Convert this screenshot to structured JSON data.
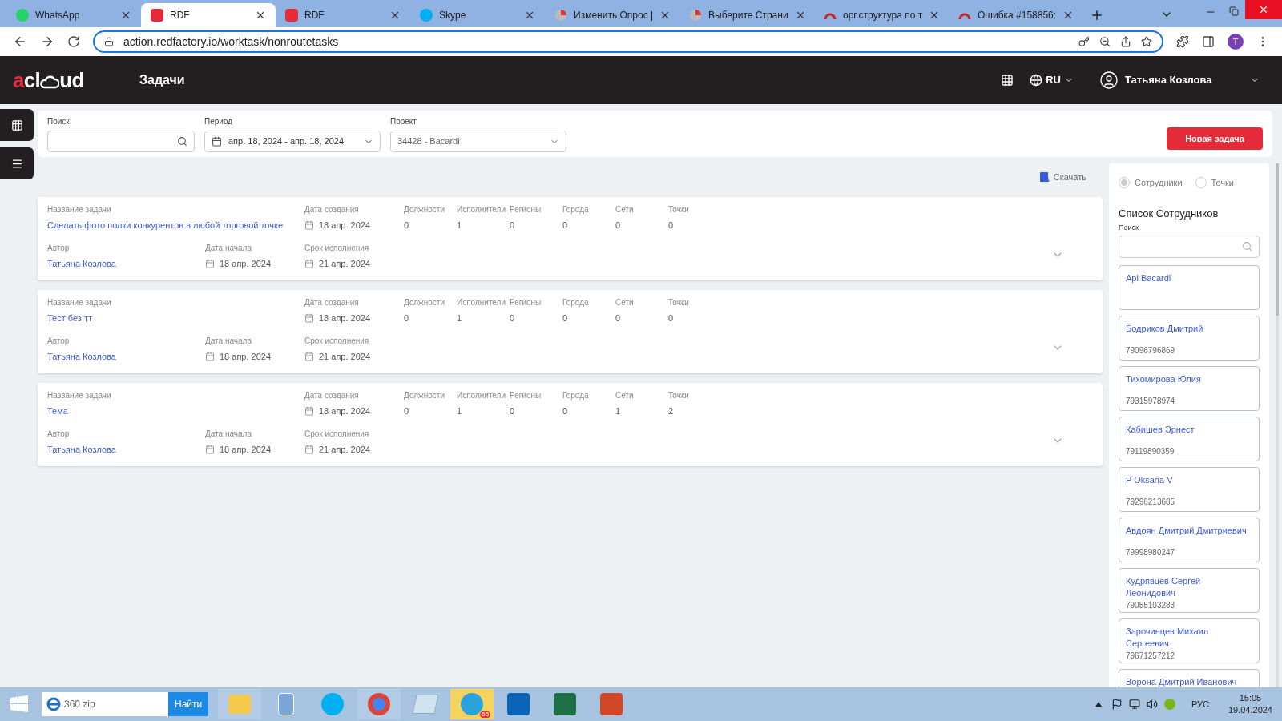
{
  "browser": {
    "tabs": [
      {
        "title": "WhatsApp",
        "kind": "whatsapp",
        "selected": false
      },
      {
        "title": "RDF",
        "kind": "rdf",
        "selected": true
      },
      {
        "title": "RDF",
        "kind": "rdf",
        "selected": false
      },
      {
        "title": "Skype",
        "kind": "skype",
        "selected": false
      },
      {
        "title": "Изменить Опрос |",
        "kind": "pie",
        "selected": false
      },
      {
        "title": "Выберите Страни",
        "kind": "pie",
        "selected": false
      },
      {
        "title": "орг.структура по т",
        "kind": "arc",
        "selected": false
      },
      {
        "title": "Ошибка #158856:",
        "kind": "arc",
        "selected": false
      }
    ],
    "url": "action.redfactory.io/worktask/nonroutetasks",
    "profile": "T"
  },
  "header": {
    "logo": {
      "mark": "a",
      "middle": "cl",
      "end": "ud"
    },
    "title": "Задачи",
    "language": "RU",
    "user": "Татьяна Козлова"
  },
  "filters": {
    "search": {
      "label": "Поиск"
    },
    "period": {
      "label": "Период",
      "value": "апр. 18, 2024 - апр. 18, 2024"
    },
    "project": {
      "label": "Проект",
      "value": "34428 - Bacardi"
    },
    "new_button": "Новая задача"
  },
  "download": "Скачать",
  "tasks": [
    {
      "name_label": "Название задачи",
      "name": "Сделать фото полки конкурентов в любой торговой точке",
      "created_label": "Дата создания",
      "created": "18 апр. 2024",
      "counts": [
        {
          "label": "Должности",
          "value": "0"
        },
        {
          "label": "Исполнители",
          "value": "1"
        },
        {
          "label": "Регионы",
          "value": "0"
        },
        {
          "label": "Города",
          "value": "0"
        },
        {
          "label": "Сети",
          "value": "0"
        },
        {
          "label": "Точки",
          "value": "0"
        }
      ],
      "author_label": "Автор",
      "author": "Татьяна Козлова",
      "start_label": "Дата начала",
      "start": "18 апр. 2024",
      "due_label": "Срок исполнения",
      "due": "21 апр. 2024"
    },
    {
      "name_label": "Название задачи",
      "name": "Тест без тт",
      "created_label": "Дата создания",
      "created": "18 апр. 2024",
      "counts": [
        {
          "label": "Должности",
          "value": "0"
        },
        {
          "label": "Исполнители",
          "value": "1"
        },
        {
          "label": "Регионы",
          "value": "0"
        },
        {
          "label": "Города",
          "value": "0"
        },
        {
          "label": "Сети",
          "value": "0"
        },
        {
          "label": "Точки",
          "value": "0"
        }
      ],
      "author_label": "Автор",
      "author": "Татьяна Козлова",
      "start_label": "Дата начала",
      "start": "18 апр. 2024",
      "due_label": "Срок исполнения",
      "due": "21 апр. 2024"
    },
    {
      "name_label": "Название задачи",
      "name": "Тема",
      "created_label": "Дата создания",
      "created": "18 апр. 2024",
      "counts": [
        {
          "label": "Должности",
          "value": "0"
        },
        {
          "label": "Исполнители",
          "value": "1"
        },
        {
          "label": "Регионы",
          "value": "0"
        },
        {
          "label": "Города",
          "value": "0"
        },
        {
          "label": "Сети",
          "value": "1"
        },
        {
          "label": "Точки",
          "value": "2"
        }
      ],
      "author_label": "Автор",
      "author": "Татьяна Козлова",
      "start_label": "Дата начала",
      "start": "18 апр. 2024",
      "due_label": "Срок исполнения",
      "due": "21 апр. 2024"
    }
  ],
  "side_panel": {
    "modes": [
      {
        "label": "Сотрудники",
        "selected": true
      },
      {
        "label": "Точки",
        "selected": false
      }
    ],
    "title": "Список Сотрудников",
    "search_label": "Поиск",
    "employees": [
      {
        "name": "Api Bacardi"
      },
      {
        "name": "Бодриков Дмитрий",
        "phone": "79096796869"
      },
      {
        "name": "Тихомирова Юлия",
        "phone": "79315978974"
      },
      {
        "name": "Кабишев Эрнест",
        "phone": "79119890359"
      },
      {
        "name": "P Oksana V",
        "phone": "79296213685"
      },
      {
        "name": "Авдоян Дмитрий Дмитриевич",
        "phone": "79998980247"
      },
      {
        "name": "Кудрявцев Сергей Леонидович",
        "phone": "79055103283"
      },
      {
        "name": "Зарочинцев Михаил Сергеевич",
        "phone": "79671257212"
      },
      {
        "name": "Ворона Дмитрий Иванович"
      }
    ]
  },
  "taskbar": {
    "search_value": "360 zip",
    "search_button": "Найти",
    "apps": [
      {
        "kind": "explorer"
      },
      {
        "kind": "calculator"
      },
      {
        "kind": "skype"
      },
      {
        "kind": "chrome"
      },
      {
        "kind": "notepad"
      },
      {
        "kind": "telegram",
        "badge": "55"
      },
      {
        "kind": "outlook"
      },
      {
        "kind": "excel"
      },
      {
        "kind": "powerpoint"
      }
    ],
    "language": "РУС",
    "time": "15:05",
    "date": "19.04.2024"
  }
}
